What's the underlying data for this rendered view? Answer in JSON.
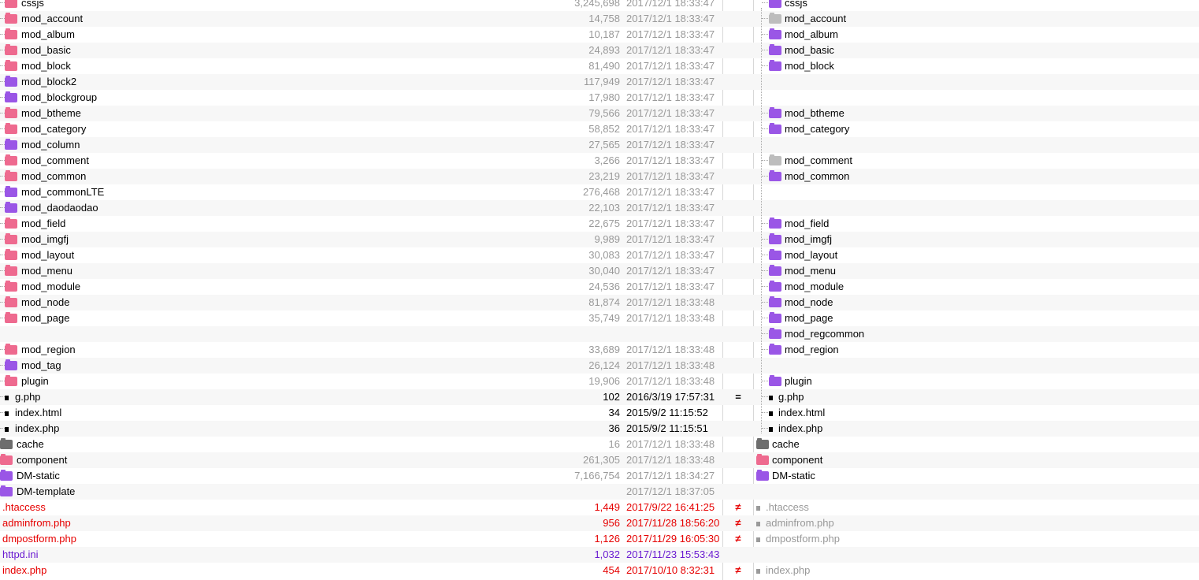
{
  "rows": [
    {
      "l": {
        "name": "cssjs",
        "icon": "folder-pink-icon",
        "size": "3,245,698",
        "date": "2017/12/1 18:33:47",
        "indent": 1,
        "color": "black"
      },
      "ind": "",
      "r": {
        "name": "cssjs",
        "icon": "folder-purple-icon",
        "indent": 1,
        "color": "black"
      }
    },
    {
      "l": {
        "name": "mod_account",
        "icon": "folder-pink-icon",
        "size": "14,758",
        "date": "2017/12/1 18:33:47",
        "indent": 1,
        "color": "black"
      },
      "ind": "",
      "r": {
        "name": "mod_account",
        "icon": "folder-gray-icon",
        "indent": 1,
        "color": "black"
      }
    },
    {
      "l": {
        "name": "mod_album",
        "icon": "folder-pink-icon",
        "size": "10,187",
        "date": "2017/12/1 18:33:47",
        "indent": 1,
        "color": "black"
      },
      "ind": "",
      "r": {
        "name": "mod_album",
        "icon": "folder-purple-icon",
        "indent": 1,
        "color": "black"
      }
    },
    {
      "l": {
        "name": "mod_basic",
        "icon": "folder-pink-icon",
        "size": "24,893",
        "date": "2017/12/1 18:33:47",
        "indent": 1,
        "color": "black"
      },
      "ind": "",
      "r": {
        "name": "mod_basic",
        "icon": "folder-purple-icon",
        "indent": 1,
        "color": "black"
      }
    },
    {
      "l": {
        "name": "mod_block",
        "icon": "folder-pink-icon",
        "size": "81,490",
        "date": "2017/12/1 18:33:47",
        "indent": 1,
        "color": "black"
      },
      "ind": "",
      "r": {
        "name": "mod_block",
        "icon": "folder-purple-icon",
        "indent": 1,
        "color": "black"
      }
    },
    {
      "l": {
        "name": "mod_block2",
        "icon": "folder-purple-icon",
        "size": "117,949",
        "date": "2017/12/1 18:33:47",
        "indent": 1,
        "color": "black"
      },
      "ind": "",
      "r": null
    },
    {
      "l": {
        "name": "mod_blockgroup",
        "icon": "folder-purple-icon",
        "size": "17,980",
        "date": "2017/12/1 18:33:47",
        "indent": 1,
        "color": "black"
      },
      "ind": "",
      "r": null
    },
    {
      "l": {
        "name": "mod_btheme",
        "icon": "folder-pink-icon",
        "size": "79,566",
        "date": "2017/12/1 18:33:47",
        "indent": 1,
        "color": "black"
      },
      "ind": "",
      "r": {
        "name": "mod_btheme",
        "icon": "folder-purple-icon",
        "indent": 1,
        "color": "black"
      }
    },
    {
      "l": {
        "name": "mod_category",
        "icon": "folder-pink-icon",
        "size": "58,852",
        "date": "2017/12/1 18:33:47",
        "indent": 1,
        "color": "black"
      },
      "ind": "",
      "r": {
        "name": "mod_category",
        "icon": "folder-purple-icon",
        "indent": 1,
        "color": "black"
      }
    },
    {
      "l": {
        "name": "mod_column",
        "icon": "folder-purple-icon",
        "size": "27,565",
        "date": "2017/12/1 18:33:47",
        "indent": 1,
        "color": "black"
      },
      "ind": "",
      "r": null
    },
    {
      "l": {
        "name": "mod_comment",
        "icon": "folder-pink-icon",
        "size": "3,266",
        "date": "2017/12/1 18:33:47",
        "indent": 1,
        "color": "black"
      },
      "ind": "",
      "r": {
        "name": "mod_comment",
        "icon": "folder-gray-icon",
        "indent": 1,
        "color": "black"
      }
    },
    {
      "l": {
        "name": "mod_common",
        "icon": "folder-pink-icon",
        "size": "23,219",
        "date": "2017/12/1 18:33:47",
        "indent": 1,
        "color": "black"
      },
      "ind": "",
      "r": {
        "name": "mod_common",
        "icon": "folder-purple-icon",
        "indent": 1,
        "color": "black"
      }
    },
    {
      "l": {
        "name": "mod_commonLTE",
        "icon": "folder-purple-icon",
        "size": "276,468",
        "date": "2017/12/1 18:33:47",
        "indent": 1,
        "color": "black"
      },
      "ind": "",
      "r": null
    },
    {
      "l": {
        "name": "mod_daodaodao",
        "icon": "folder-purple-icon",
        "size": "22,103",
        "date": "2017/12/1 18:33:47",
        "indent": 1,
        "color": "black"
      },
      "ind": "",
      "r": null
    },
    {
      "l": {
        "name": "mod_field",
        "icon": "folder-pink-icon",
        "size": "22,675",
        "date": "2017/12/1 18:33:47",
        "indent": 1,
        "color": "black"
      },
      "ind": "",
      "r": {
        "name": "mod_field",
        "icon": "folder-purple-icon",
        "indent": 1,
        "color": "black"
      }
    },
    {
      "l": {
        "name": "mod_imgfj",
        "icon": "folder-pink-icon",
        "size": "9,989",
        "date": "2017/12/1 18:33:47",
        "indent": 1,
        "color": "black"
      },
      "ind": "",
      "r": {
        "name": "mod_imgfj",
        "icon": "folder-purple-icon",
        "indent": 1,
        "color": "black"
      }
    },
    {
      "l": {
        "name": "mod_layout",
        "icon": "folder-pink-icon",
        "size": "30,083",
        "date": "2017/12/1 18:33:47",
        "indent": 1,
        "color": "black"
      },
      "ind": "",
      "r": {
        "name": "mod_layout",
        "icon": "folder-purple-icon",
        "indent": 1,
        "color": "black"
      }
    },
    {
      "l": {
        "name": "mod_menu",
        "icon": "folder-pink-icon",
        "size": "30,040",
        "date": "2017/12/1 18:33:47",
        "indent": 1,
        "color": "black"
      },
      "ind": "",
      "r": {
        "name": "mod_menu",
        "icon": "folder-purple-icon",
        "indent": 1,
        "color": "black"
      }
    },
    {
      "l": {
        "name": "mod_module",
        "icon": "folder-pink-icon",
        "size": "24,536",
        "date": "2017/12/1 18:33:47",
        "indent": 1,
        "color": "black"
      },
      "ind": "",
      "r": {
        "name": "mod_module",
        "icon": "folder-purple-icon",
        "indent": 1,
        "color": "black"
      }
    },
    {
      "l": {
        "name": "mod_node",
        "icon": "folder-pink-icon",
        "size": "81,874",
        "date": "2017/12/1 18:33:48",
        "indent": 1,
        "color": "black"
      },
      "ind": "",
      "r": {
        "name": "mod_node",
        "icon": "folder-purple-icon",
        "indent": 1,
        "color": "black"
      }
    },
    {
      "l": {
        "name": "mod_page",
        "icon": "folder-pink-icon",
        "size": "35,749",
        "date": "2017/12/1 18:33:48",
        "indent": 1,
        "color": "black"
      },
      "ind": "",
      "r": {
        "name": "mod_page",
        "icon": "folder-purple-icon",
        "indent": 1,
        "color": "black"
      }
    },
    {
      "l": null,
      "ind": "",
      "r": {
        "name": "mod_regcommon",
        "icon": "folder-purple-icon",
        "indent": 1,
        "color": "black"
      }
    },
    {
      "l": {
        "name": "mod_region",
        "icon": "folder-pink-icon",
        "size": "33,689",
        "date": "2017/12/1 18:33:48",
        "indent": 1,
        "color": "black"
      },
      "ind": "",
      "r": {
        "name": "mod_region",
        "icon": "folder-purple-icon",
        "indent": 1,
        "color": "black"
      }
    },
    {
      "l": {
        "name": "mod_tag",
        "icon": "folder-purple-icon",
        "size": "26,124",
        "date": "2017/12/1 18:33:48",
        "indent": 1,
        "color": "black"
      },
      "ind": "",
      "r": null
    },
    {
      "l": {
        "name": "plugin",
        "icon": "folder-pink-icon",
        "size": "19,906",
        "date": "2017/12/1 18:33:48",
        "indent": 1,
        "color": "black"
      },
      "ind": "",
      "r": {
        "name": "plugin",
        "icon": "folder-purple-icon",
        "indent": 1,
        "color": "black"
      }
    },
    {
      "l": {
        "name": "g.php",
        "icon": "file-icon",
        "size": "102",
        "date": "2016/3/19 17:57:31",
        "indent": 1,
        "color": "black",
        "meta": "black"
      },
      "ind": "=",
      "r": {
        "name": "g.php",
        "icon": "file-icon",
        "indent": 1,
        "color": "black"
      }
    },
    {
      "l": {
        "name": "index.html",
        "icon": "file-icon",
        "size": "34",
        "date": "2015/9/2 11:15:52",
        "indent": 1,
        "color": "black",
        "meta": "black"
      },
      "ind": "",
      "r": {
        "name": "index.html",
        "icon": "file-icon",
        "indent": 1,
        "color": "black"
      }
    },
    {
      "l": {
        "name": "index.php",
        "icon": "file-icon",
        "size": "36",
        "date": "2015/9/2 11:15:51",
        "indent": 1,
        "color": "black",
        "meta": "black"
      },
      "ind": "",
      "r": {
        "name": "index.php",
        "icon": "file-icon",
        "indent": 1,
        "color": "black"
      }
    },
    {
      "l": {
        "name": "cache",
        "icon": "folder-dark-icon",
        "size": "16",
        "date": "2017/12/1 18:33:48",
        "indent": 0,
        "color": "black"
      },
      "ind": "",
      "r": {
        "name": "cache",
        "icon": "folder-dark-icon",
        "indent": 0,
        "color": "black"
      }
    },
    {
      "l": {
        "name": "component",
        "icon": "folder-pink-icon",
        "size": "261,305",
        "date": "2017/12/1 18:33:48",
        "indent": 0,
        "color": "black"
      },
      "ind": "",
      "r": {
        "name": "component",
        "icon": "folder-pink-icon",
        "indent": 0,
        "color": "black"
      }
    },
    {
      "l": {
        "name": "DM-static",
        "icon": "folder-purple-icon",
        "size": "7,166,754",
        "date": "2017/12/1 18:34:27",
        "indent": 0,
        "color": "black"
      },
      "ind": "",
      "r": {
        "name": "DM-static",
        "icon": "folder-purple-icon",
        "indent": 0,
        "color": "black"
      }
    },
    {
      "l": {
        "name": "DM-template",
        "icon": "folder-purple-icon",
        "size": "",
        "date": "2017/12/1 18:37:05",
        "indent": 0,
        "color": "black"
      },
      "ind": "",
      "r": null
    },
    {
      "l": {
        "name": ".htaccess",
        "icon": "",
        "size": "1,449",
        "date": "2017/9/22 16:41:25",
        "indent": 0,
        "color": "red",
        "meta": "red"
      },
      "ind": "≠",
      "r": {
        "name": ".htaccess",
        "icon": "file-gray-icon",
        "indent": 0,
        "color": "gray"
      }
    },
    {
      "l": {
        "name": "adminfrom.php",
        "icon": "",
        "size": "956",
        "date": "2017/11/28 18:56:20",
        "indent": 0,
        "color": "red",
        "meta": "red"
      },
      "ind": "≠",
      "r": {
        "name": "adminfrom.php",
        "icon": "file-gray-icon",
        "indent": 0,
        "color": "gray"
      }
    },
    {
      "l": {
        "name": "dmpostform.php",
        "icon": "",
        "size": "1,126",
        "date": "2017/11/29 16:05:30",
        "indent": 0,
        "color": "red",
        "meta": "red"
      },
      "ind": "≠",
      "r": {
        "name": "dmpostform.php",
        "icon": "file-gray-icon",
        "indent": 0,
        "color": "gray"
      }
    },
    {
      "l": {
        "name": "httpd.ini",
        "icon": "",
        "size": "1,032",
        "date": "2017/11/23 15:53:43",
        "indent": 0,
        "color": "purple",
        "meta": "purple"
      },
      "ind": "",
      "r": null
    },
    {
      "l": {
        "name": "index.php",
        "icon": "",
        "size": "454",
        "date": "2017/10/10 8:32:31",
        "indent": 0,
        "color": "red",
        "meta": "red"
      },
      "ind": "≠",
      "r": {
        "name": "index.php",
        "icon": "file-gray-icon",
        "indent": 0,
        "color": "gray"
      }
    }
  ],
  "colors": {
    "alt_row": "#f7f7f7",
    "red": "#e60000",
    "purple": "#6a1bd1",
    "meta_gray": "#999999"
  }
}
